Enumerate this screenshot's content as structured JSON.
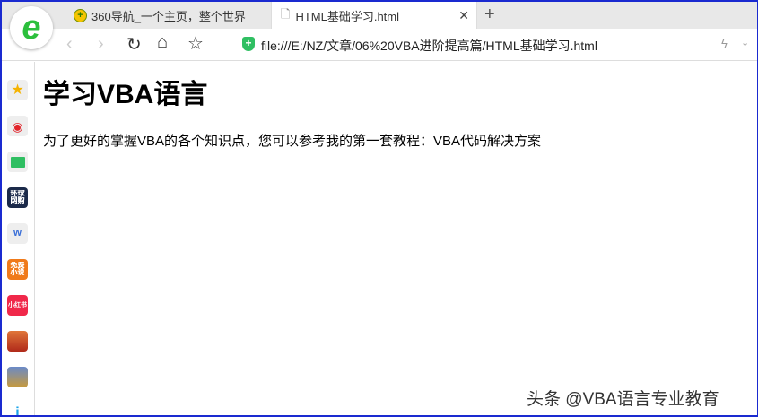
{
  "tabs": [
    {
      "label": "360导航_一个主页，整个世界",
      "active": false
    },
    {
      "label": "HTML基础学习.html",
      "active": true
    }
  ],
  "toolbar": {
    "url": "file:///E:/NZ/文章/06%20VBA进阶提高篇/HTML基础学习.html"
  },
  "sidebar": {
    "items": [
      "favorites",
      "weibo",
      "mail",
      "环球网购",
      "word",
      "免费小说",
      "小红书",
      "game",
      "game2",
      "app"
    ],
    "labels": {
      "huanqiu": "环球\n网购",
      "novel": "免费\n小说",
      "xhs": "小红书"
    }
  },
  "page": {
    "heading": "学习VBA语言",
    "paragraph": "为了更好的掌握VBA的各个知识点，您可以参考我的第一套教程：VBA代码解决方案"
  },
  "watermark": "头条 @VBA语言专业教育"
}
